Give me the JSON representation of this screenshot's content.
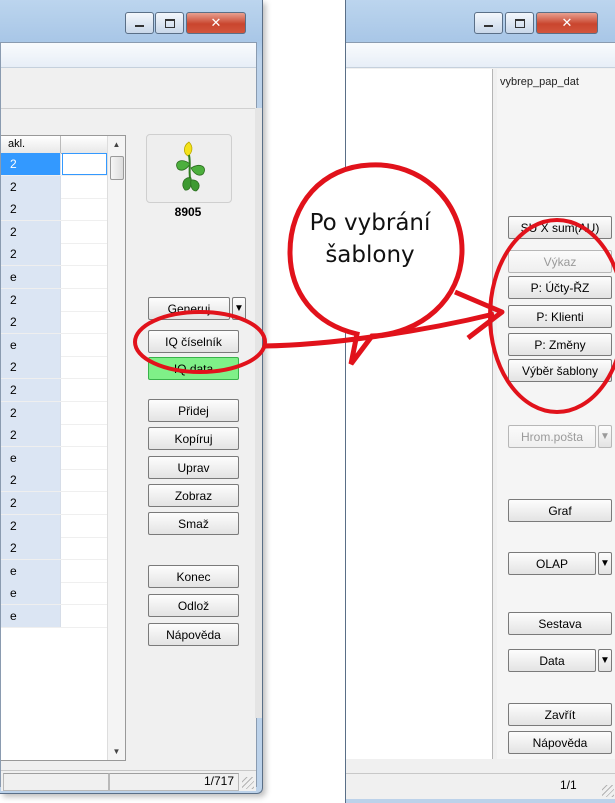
{
  "left_window": {
    "grid_header": "akl.",
    "grid_rows": [
      "2",
      "2",
      "2",
      "2",
      "2",
      "e",
      "2",
      "2",
      "e",
      "2",
      "2",
      "2",
      "2",
      "e",
      "2",
      "2",
      "2",
      "2",
      "e",
      "e",
      "e"
    ],
    "selected_row": 0,
    "logo_code": "8905",
    "buttons": {
      "generuj": "Generuj",
      "iq_ciselnik": "IQ číselník",
      "iq_data": "IQ data",
      "pridej": "Přidej",
      "kopiruj": "Kopíruj",
      "uprav": "Uprav",
      "zobraz": "Zobraz",
      "smaz": "Smaž",
      "konec": "Konec",
      "odloz": "Odlož",
      "napoveda": "Nápověda"
    },
    "pager": "1/717"
  },
  "right_window": {
    "procedure_name": "vybrep_pap_dat",
    "buttons": {
      "su_x_sum": "SU X sum(AU)",
      "vykaz": "Výkaz",
      "p_ucty_rz": "P: Účty-ŘZ",
      "p_klienti": "P: Klienti",
      "p_zmeny": "P: Změny",
      "vyber_sablony": "Výběr šablony",
      "hrom_posta": "Hrom.pošta",
      "graf": "Graf",
      "olap": "OLAP",
      "sestava": "Sestava",
      "data": "Data",
      "zavrit": "Zavřít",
      "napoveda": "Nápověda"
    },
    "pager": "1/1"
  },
  "callout": {
    "text_line1": "Po vybrání",
    "text_line2": "šablony"
  },
  "colors": {
    "annotation_red": "#e1121b",
    "highlight_green": "#7ff088",
    "selection_blue": "#3399ff",
    "close_button_red": "#c9452e"
  },
  "icons": [
    "minimize-icon",
    "maximize-icon",
    "close-icon",
    "flower-logo-icon",
    "dropdown-arrow-icon",
    "scroll-up-arrow-icon",
    "scroll-down-arrow-icon",
    "resize-grip-icon"
  ]
}
